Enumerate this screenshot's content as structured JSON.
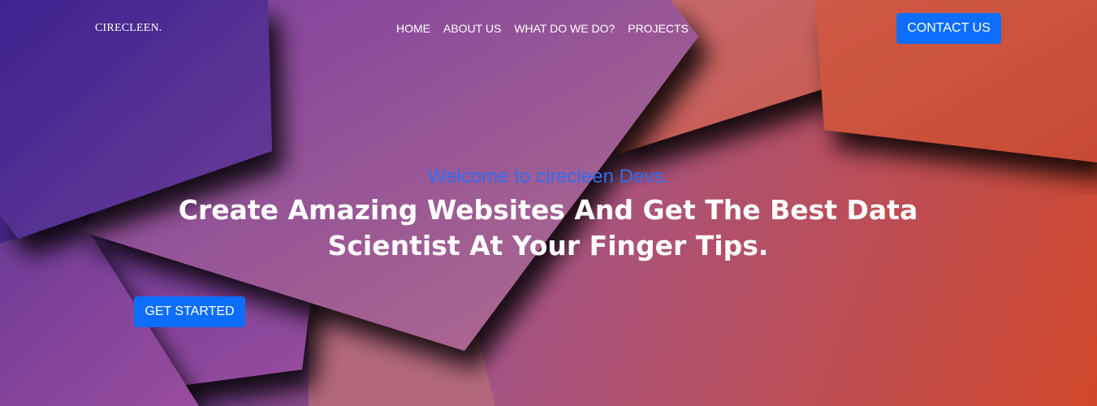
{
  "header": {
    "brand": "CIRECLEEN.",
    "nav": [
      "HOME",
      "ABOUT US",
      "WHAT DO WE DO?",
      "PROJECTS"
    ],
    "contact_label": "CONTACT US"
  },
  "hero": {
    "welcome": "Welcome to cirecleen Devs.",
    "headline": "Create Amazing Websites And Get The Best Data Scientist At Your Finger Tips.",
    "cta_label": "GET STARTED"
  },
  "colors": {
    "button_primary": "#0d6efd",
    "welcome_text": "#2f6ef0",
    "gradient_start": "#3b2191",
    "gradient_mid": "#a0558f",
    "gradient_end": "#d1482b"
  }
}
